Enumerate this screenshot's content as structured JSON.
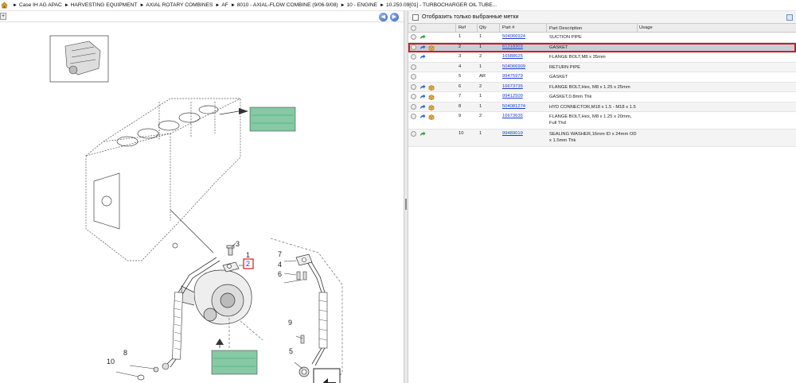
{
  "breadcrumb": {
    "items": [
      "Case IH AG APAC",
      "HARVESTING EQUIPMENT",
      "AXIAL ROTARY COMBINES",
      "AF",
      "8010 - AXIAL-FLOW COMBINE (9/06-9/08)",
      "10 - ENGINE",
      "10.250.09[01] - TURBOCHARGER OIL TUBE..."
    ],
    "separator": "►"
  },
  "diagram": {
    "callouts": [
      "3",
      "1",
      "2",
      "7",
      "4",
      "6",
      "9",
      "5",
      "8",
      "10"
    ],
    "selected_callout": "2"
  },
  "filter": {
    "label": "Отобразить только выбранные метки",
    "checked": false
  },
  "table": {
    "headers": {
      "ref": "Ref",
      "qty": "Qty",
      "part": "Part #",
      "desc": "Part Description",
      "usage": "Usage"
    },
    "rows": [
      {
        "icons": [
          "arrow-green"
        ],
        "ref": "1",
        "qty": "1",
        "part": "504066924",
        "desc": "SUCTION PIPE",
        "usage": ""
      },
      {
        "icons": [
          "arrow-blue",
          "box"
        ],
        "ref": "2",
        "qty": "1",
        "part": "61318303",
        "desc": "GASKET",
        "usage": "",
        "selected": true
      },
      {
        "icons": [
          "arrow-blue"
        ],
        "ref": "3",
        "qty": "2",
        "part": "16588625",
        "desc": "FLANGE BOLT,M8 x 35mm",
        "usage": ""
      },
      {
        "icons": [],
        "ref": "4",
        "qty": "1",
        "part": "504066909",
        "desc": "RETURN PIPE",
        "usage": ""
      },
      {
        "icons": [],
        "ref": "5",
        "qty": "AR",
        "part": "99475979",
        "desc": "GASKET",
        "usage": ""
      },
      {
        "icons": [
          "arrow-blue",
          "box"
        ],
        "ref": "6",
        "qty": "2",
        "part": "16673735",
        "desc": "FLANGE BOLT,Hex, M8 x 1.25 x 25mm",
        "usage": ""
      },
      {
        "icons": [
          "arrow-blue",
          "box"
        ],
        "ref": "7",
        "qty": "1",
        "part": "99412509",
        "desc": "GASKET,0.8mm Thk",
        "usage": ""
      },
      {
        "icons": [
          "arrow-blue",
          "box"
        ],
        "ref": "8",
        "qty": "1",
        "part": "504081274",
        "desc": "HYD CONNECTOR,M18 x 1.5 - M18 x 1.5",
        "usage": ""
      },
      {
        "icons": [
          "arrow-blue",
          "box"
        ],
        "ref": "9",
        "qty": "2",
        "part": "16673635",
        "desc": "FLANGE BOLT,Hex, M8 x 1.25 x 20mm, Full Thd",
        "usage": "",
        "tall": true
      },
      {
        "icons": [
          "arrow-green"
        ],
        "ref": "10",
        "qty": "1",
        "part": "99489019",
        "desc": "SEALING WASHER,16mm ID x 24mm OD x 1.5mm Thk",
        "usage": "",
        "tall": true
      }
    ]
  },
  "colors": {
    "link": "#1a3fcc",
    "selection_border": "#d21b1b",
    "selection_bg": "#c9cdd6",
    "label_tag": "#86c9a4"
  }
}
